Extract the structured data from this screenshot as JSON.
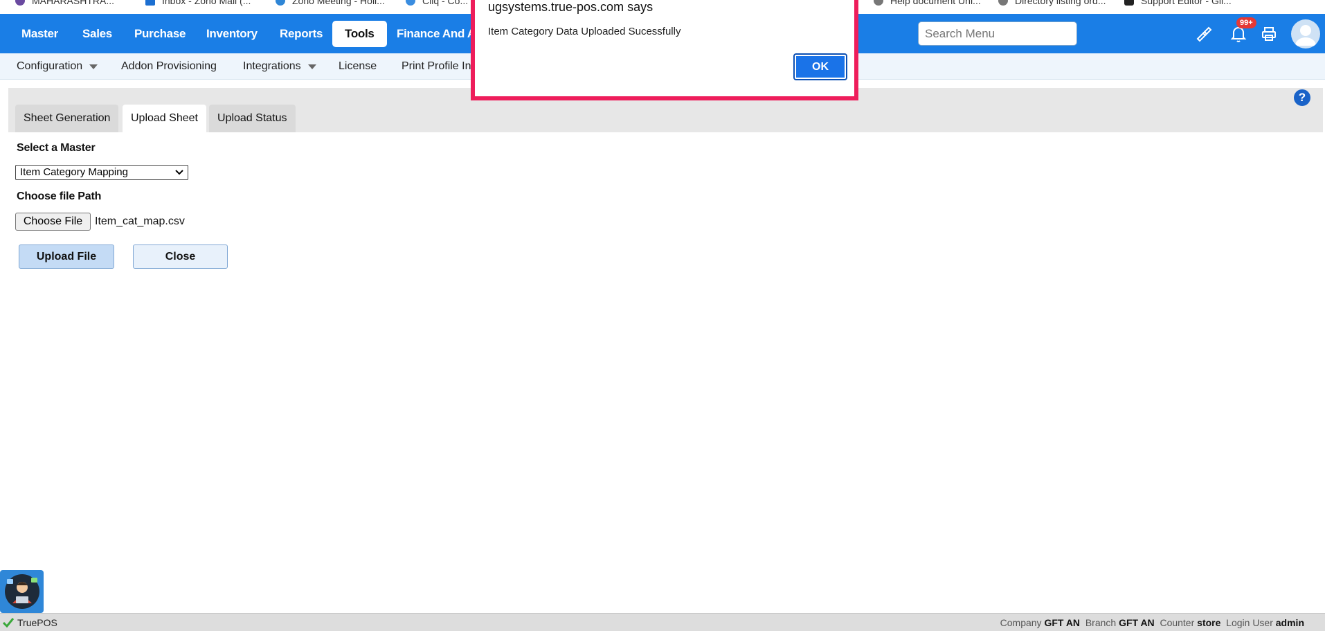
{
  "bookmarks": [
    "MAHARASHTRA...",
    "Inbox - Zoho Mail (...",
    "Zoho Meeting - Holi...",
    "Cliq - Co...",
    "Help document Uni...",
    "Directory listing ord...",
    "Support Editor - Gli..."
  ],
  "nav": {
    "items": [
      "Master",
      "Sales",
      "Purchase",
      "Inventory",
      "Reports",
      "Tools",
      "Finance And Ac"
    ],
    "active": "Tools",
    "search_placeholder": "Search Menu",
    "notification_count": "99+"
  },
  "subnav": {
    "items": [
      "Configuration",
      "Addon Provisioning",
      "Integrations",
      "License",
      "Print Profile In"
    ]
  },
  "tabs": [
    "Sheet Generation",
    "Upload Sheet",
    "Upload Status"
  ],
  "active_tab": "Upload Sheet",
  "form": {
    "master_label": "Select a Master",
    "master_value": "Item Category Mapping",
    "file_label": "Choose file Path",
    "file_button": "Choose File",
    "file_name": "Item_cat_map.csv",
    "upload_button": "Upload File",
    "close_button": "Close"
  },
  "dialog": {
    "title": "ugsystems.true-pos.com says",
    "message": "Item Category Data Uploaded Sucessfully",
    "ok": "OK"
  },
  "footer": {
    "brand": "TruePOS",
    "company_label": "Company",
    "company": "GFT AN",
    "branch_label": "Branch",
    "branch": "GFT AN",
    "counter_label": "Counter",
    "counter": "store",
    "user_label": "Login User",
    "user": "admin"
  },
  "colors": {
    "nav_bg": "#1a7ee6",
    "dialog_border": "#ee1d5b",
    "ok_button": "#1a73e8"
  },
  "icons": [
    "brush-icon",
    "bell-icon",
    "printer-icon",
    "user-avatar-icon",
    "help-icon",
    "chatbot-icon",
    "check-icon"
  ]
}
